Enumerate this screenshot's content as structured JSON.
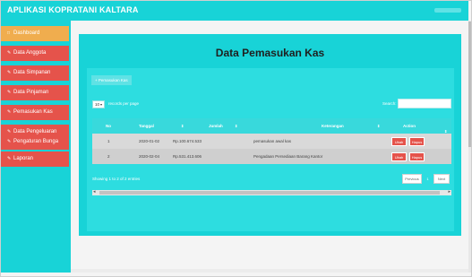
{
  "app": {
    "brand": "APLIKASI KOPRATANI KALTARA"
  },
  "sidebar": {
    "items": [
      {
        "label": "Dashboard",
        "icon": "home-icon",
        "active": true
      },
      {
        "label": "Data Anggota",
        "icon": "page-icon",
        "active": false
      },
      {
        "label": "Data Simpanan",
        "icon": "page-icon",
        "active": false
      },
      {
        "label": "Data Pinjaman",
        "icon": "page-icon",
        "active": false
      },
      {
        "label": "Pemasukan Kas",
        "icon": "page-icon",
        "active": false
      },
      {
        "label": "Data Pengeluaran",
        "icon": "page-icon",
        "active": false
      },
      {
        "label": "Pengaturan Bunga",
        "icon": "page-icon",
        "active": false
      },
      {
        "label": "Laporan",
        "icon": "page-icon",
        "active": false
      }
    ]
  },
  "main": {
    "title": "Data Pemasukan Kas",
    "add_button": "+ Pemasukan Kas",
    "length": {
      "value": "10",
      "text": "records per page"
    },
    "search": {
      "label": "Search:",
      "value": ""
    },
    "table": {
      "headers": [
        "No",
        "Tanggal",
        "Jumlah",
        "Keterangan",
        "Action"
      ],
      "rows": [
        {
          "no": "1",
          "tanggal": "2020-01-02",
          "jumlah": "Rp.100.674.533",
          "keterangan": "pemasukan awal kas",
          "edit": "Ubah",
          "delete": "Hapus"
        },
        {
          "no": "2",
          "tanggal": "2020-02-04",
          "jumlah": "Rp.531.413.606",
          "keterangan": "Pengadaan Persediaan Barang Kantor",
          "edit": "Ubah",
          "delete": "Hapus"
        }
      ]
    },
    "info": "Showing 1 to 2 of 2 entries",
    "pagination": {
      "previous": "Previous",
      "current": "1",
      "next": "Next"
    }
  },
  "colors": {
    "accent": "#18d3d7",
    "danger": "#e5534b",
    "active": "#f0ad4e"
  }
}
